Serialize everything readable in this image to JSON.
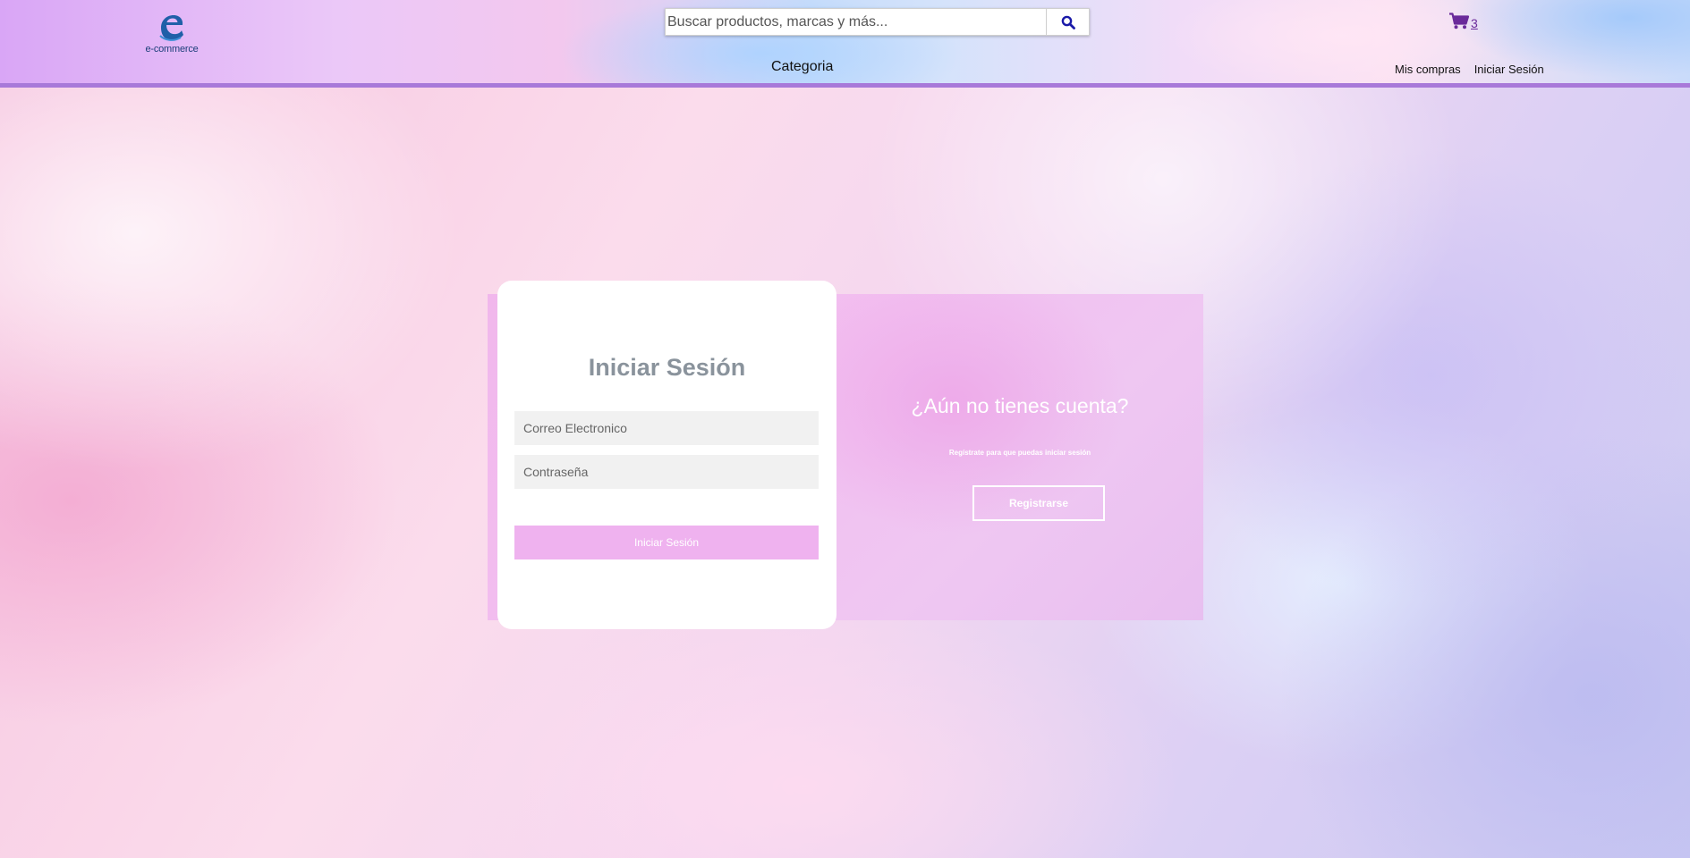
{
  "header": {
    "logo_text": "e-commerce",
    "search": {
      "placeholder": "Buscar productos, marcas y más...",
      "icon": "search-icon"
    },
    "cart": {
      "icon": "cart-icon",
      "count": "3"
    },
    "category_label": "Categoria",
    "nav": {
      "my_purchases": "Mis compras",
      "login": "Iniciar Sesión"
    }
  },
  "login": {
    "title": "Iniciar Sesión",
    "email_placeholder": "Correo Electronico",
    "password_placeholder": "Contraseña",
    "submit_label": "Iniciar Sesión"
  },
  "signup": {
    "title": "¿Aún no tienes cuenta?",
    "subtitle": "Regístrate para que puedas iniciar sesión",
    "button_label": "Registrarse"
  },
  "colors": {
    "accent": "#a879d9",
    "login_button": "#efb2ef",
    "title_gray": "#8a939c",
    "search_icon": "#1a1aa8"
  }
}
